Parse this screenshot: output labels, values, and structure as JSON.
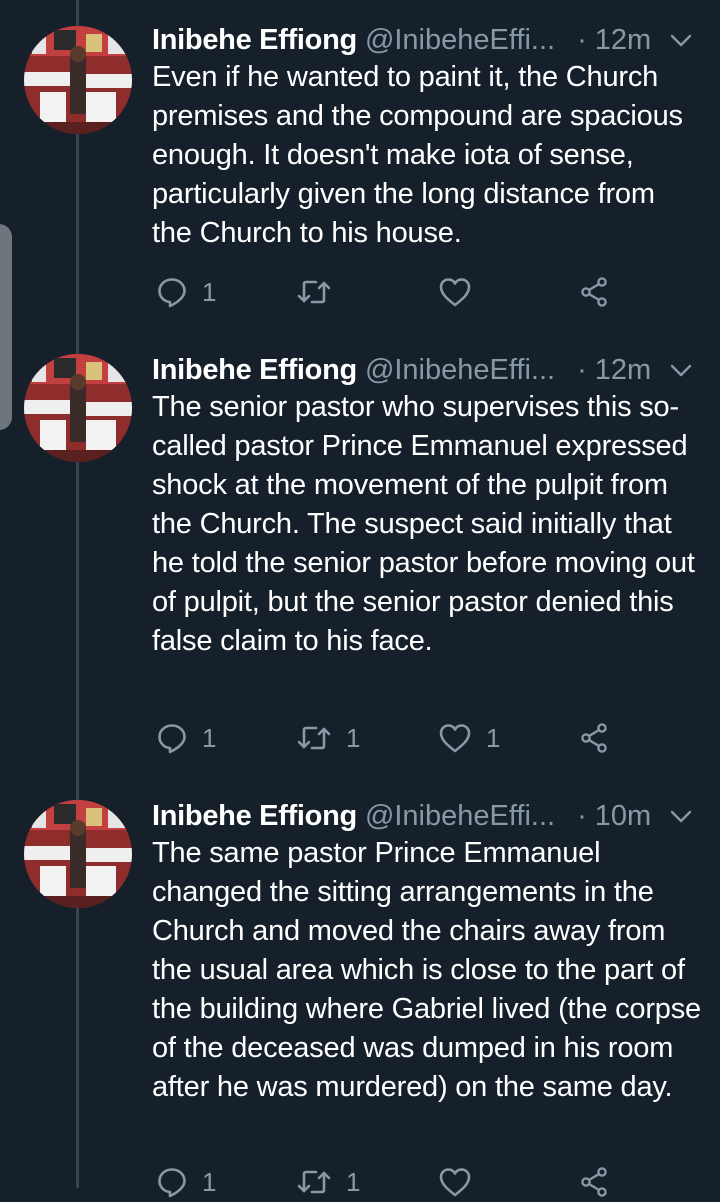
{
  "colors": {
    "background": "#15202b",
    "secondary_text": "#8899a6",
    "thread_line": "#38444d"
  },
  "icons": {
    "reply": "reply-icon",
    "retweet": "retweet-icon",
    "like": "heart-icon",
    "share": "share-icon",
    "menu": "chevron-down-icon"
  },
  "tweets": [
    {
      "name": "Inibehe Effiong",
      "handle": "@InibeheEffi",
      "ellipsis": "...",
      "time": "· 12m",
      "text": "Even if he wanted to paint it, the Church premises and the compound are spacious enough. It doesn't make iota of sense, particularly given the long distance from the Church to his house.",
      "replies": "1",
      "retweets": "",
      "likes": ""
    },
    {
      "name": "Inibehe Effiong",
      "handle": "@InibeheEffi",
      "ellipsis": "...",
      "time": "· 12m",
      "text": "The senior pastor who supervises this so-called pastor Prince Emmanuel expressed shock at the movement of the pulpit from the Church. The suspect said initially that he told the senior pastor before moving out of pulpit, but the senior pastor denied this false claim to his face.",
      "replies": "1",
      "retweets": "1",
      "likes": "1"
    },
    {
      "name": "Inibehe Effiong",
      "handle": "@InibeheEffi",
      "ellipsis": "...",
      "time": "· 10m",
      "text": "The same pastor Prince Emmanuel changed the sitting arrangements in the Church and moved the chairs away from the usual area which is close to the part of the building where Gabriel lived (the corpse of the deceased was dumped in his room after he was murdered) on the same day.",
      "replies": "1",
      "retweets": "1",
      "likes": ""
    }
  ]
}
